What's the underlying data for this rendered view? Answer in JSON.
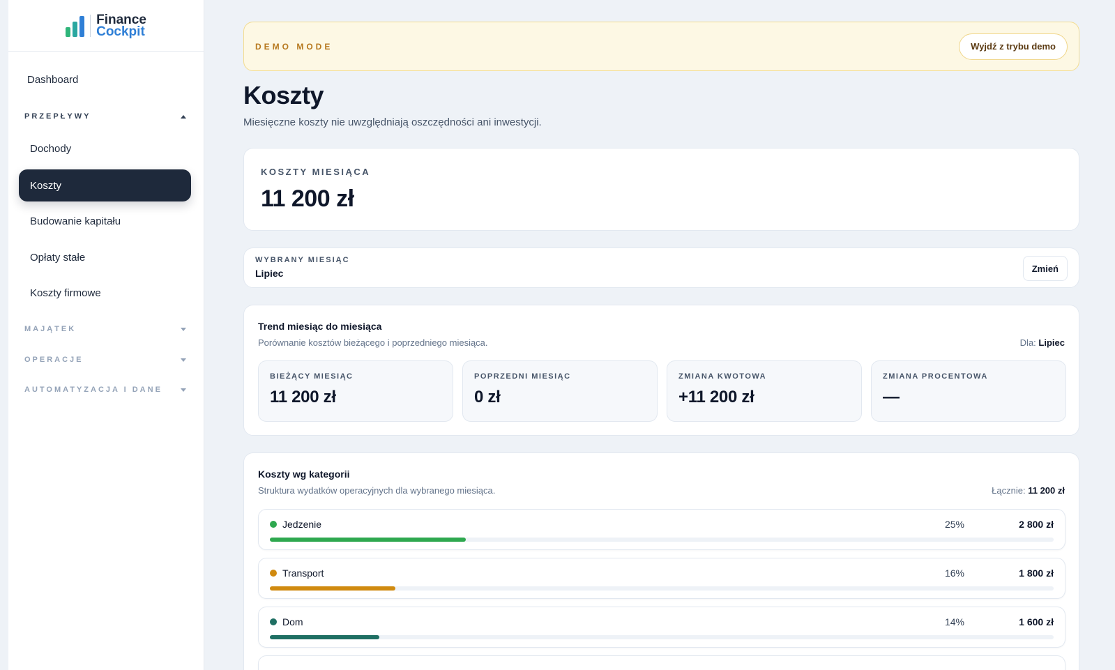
{
  "brand": {
    "line1": "Finance",
    "line2": "Cockpit",
    "bar_colors": [
      "#2fb57a",
      "#2aa7a0",
      "#2f7fd6"
    ]
  },
  "sidebar": {
    "dashboard": "Dashboard",
    "sections": [
      {
        "label": "PRZEPŁYWY",
        "state": "open"
      },
      {
        "label": "MAJĄTEK",
        "state": "closed"
      },
      {
        "label": "OPERACJE",
        "state": "closed"
      },
      {
        "label": "AUTOMATYZACJA I DANE",
        "state": "closed"
      }
    ],
    "items": [
      {
        "label": "Dochody",
        "active": false
      },
      {
        "label": "Koszty",
        "active": true
      },
      {
        "label": "Budowanie kapitału",
        "active": false
      },
      {
        "label": "Opłaty stałe",
        "active": false
      },
      {
        "label": "Koszty firmowe",
        "active": false
      }
    ]
  },
  "demo": {
    "label": "DEMO MODE",
    "exit_button": "Wyjdź z trybu demo"
  },
  "page": {
    "title": "Koszty",
    "subtitle": "Miesięczne koszty nie uwzględniają oszczędności ani inwestycji."
  },
  "kpi": {
    "label": "KOSZTY MIESIĄCA",
    "value": "11 200 zł"
  },
  "month": {
    "label": "WYBRANY MIESIĄC",
    "value": "Lipiec",
    "change_button": "Zmień"
  },
  "trend": {
    "title": "Trend miesiąc do miesiąca",
    "subtitle": "Porównanie kosztów bieżącego i poprzedniego miesiąca.",
    "for_label": "Dla:",
    "for_value": "Lipiec",
    "tiles": [
      {
        "label": "BIEŻĄCY MIESIĄC",
        "value": "11 200 zł"
      },
      {
        "label": "POPRZEDNI MIESIĄC",
        "value": "0 zł"
      },
      {
        "label": "ZMIANA KWOTOWA",
        "value": "+11 200 zł"
      },
      {
        "label": "ZMIANA PROCENTOWA",
        "value": "—"
      }
    ]
  },
  "categories": {
    "title": "Koszty wg kategorii",
    "subtitle": "Struktura wydatków operacyjnych dla wybranego miesiąca.",
    "total_label": "Łącznie:",
    "total_value": "11 200 zł",
    "items": [
      {
        "name": "Jedzenie",
        "pct": "25%",
        "share": 0.25,
        "amount": "2 800 zł",
        "color": "#2ea84f"
      },
      {
        "name": "Transport",
        "pct": "16%",
        "share": 0.16,
        "amount": "1 800 zł",
        "color": "#d08a0f"
      },
      {
        "name": "Dom",
        "pct": "14%",
        "share": 0.14,
        "amount": "1 600 zł",
        "color": "#1f6f63"
      }
    ]
  }
}
